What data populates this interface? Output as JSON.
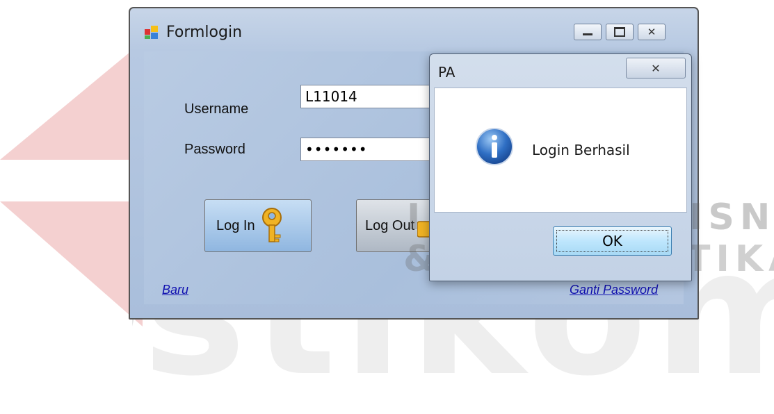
{
  "window": {
    "title": "Formlogin",
    "minimize_icon": "minimize-icon",
    "maximize_icon": "maximize-icon",
    "close_icon": "close-icon"
  },
  "form": {
    "username_label": "Username",
    "username_value": "L11014",
    "password_label": "Password",
    "password_value": "•••••••",
    "login_label": "Log In",
    "logout_label": "Log Out",
    "baru_link": "Baru",
    "ganti_password_link": "Ganti Password",
    "login_icon": "key-icon",
    "logout_icon": "lock-icon"
  },
  "dialog": {
    "title": "PA",
    "message": "Login Berhasil",
    "ok_label": "OK",
    "info_icon": "info-icon"
  },
  "watermark": {
    "line1": "INSTITUT BISNIS",
    "line2": "& INFORMATIKA",
    "line3": "stikom"
  },
  "colors": {
    "watermark_red": "#e3a3a3",
    "link_blue": "#1010b0",
    "accent": "#3c7fb1"
  }
}
